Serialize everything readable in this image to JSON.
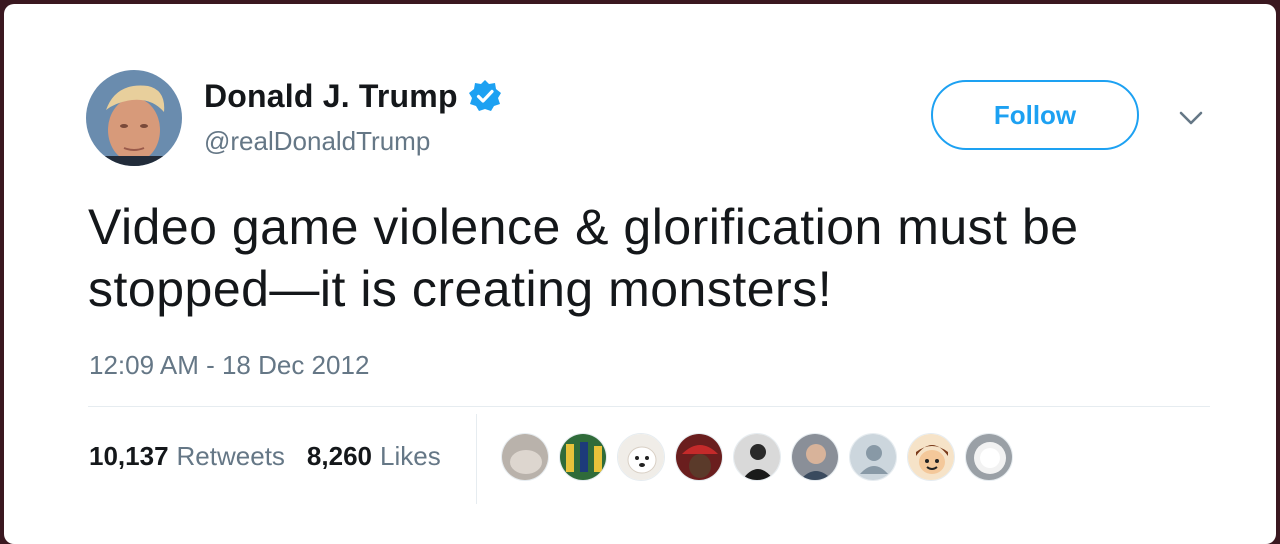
{
  "tweet": {
    "display_name": "Donald J. Trump",
    "handle": "@realDonaldTrump",
    "verified": true,
    "text": "Video game violence & glorification must be stopped—it is creating monsters!",
    "timestamp": "12:09 AM - 18 Dec 2012"
  },
  "actions": {
    "follow_label": "Follow"
  },
  "stats": {
    "retweets_count": "10,137",
    "retweets_label": "Retweets",
    "likes_count": "8,260",
    "likes_label": "Likes"
  },
  "icons": {
    "verified": "verified-badge-icon",
    "more": "chevron-down-icon"
  },
  "colors": {
    "accent": "#1da1f2",
    "text_primary": "#14171a",
    "text_secondary": "#657786",
    "divider": "#e6ecf0"
  }
}
